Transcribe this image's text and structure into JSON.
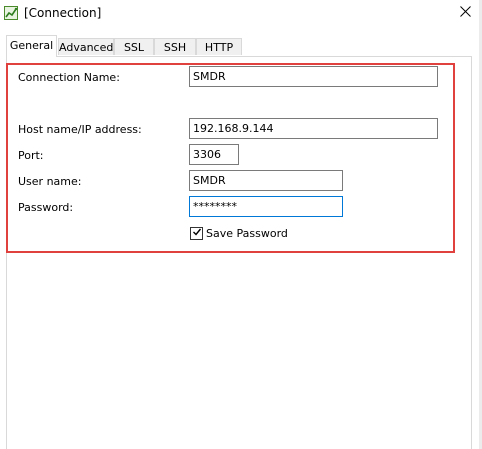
{
  "window": {
    "title": "[Connection]",
    "close_glyph": "✕"
  },
  "tabs": [
    {
      "label": "General",
      "active": true
    },
    {
      "label": "Advanced",
      "active": false
    },
    {
      "label": "SSL",
      "active": false
    },
    {
      "label": "SSH",
      "active": false
    },
    {
      "label": "HTTP",
      "active": false
    }
  ],
  "form": {
    "connection_name_label": "Connection Name:",
    "connection_name_value": "SMDR",
    "host_label": "Host name/IP address:",
    "host_value": "192.168.9.144",
    "port_label": "Port:",
    "port_value": "3306",
    "user_label": "User name:",
    "user_value": "SMDR",
    "password_label": "Password:",
    "password_value": "********",
    "save_password_label": "Save Password",
    "save_password_checked": true
  },
  "colors": {
    "highlight": "#e0413e",
    "focus_border": "#0078d7"
  },
  "icons": {
    "app": "connection-icon",
    "close": "close-icon",
    "checkbox": "checkmark-icon"
  }
}
